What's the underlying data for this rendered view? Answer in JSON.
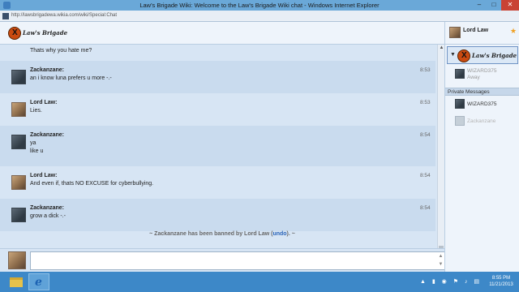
{
  "window": {
    "title": "Law's Brigade Wiki: Welcome to the Law's Brigade Wiki chat - Windows Internet Explorer",
    "minimize": "–",
    "maximize": "□",
    "close": "✕"
  },
  "address": {
    "url": "http://lawsbrigadewa.wikia.com/wiki/Special:Chat"
  },
  "logo_text": "Law's Brigade",
  "messages": [
    {
      "user": "",
      "time": "",
      "lines": [
        "Thats why you hate me?"
      ]
    },
    {
      "user": "Zackanzane:",
      "time": "8:53",
      "lines": [
        "an i know luna prefers u more -.-"
      ]
    },
    {
      "user": "Lord Law:",
      "time": "8:53",
      "lines": [
        "Lies."
      ]
    },
    {
      "user": "Zackanzane:",
      "time": "8:54",
      "lines": [
        "ya",
        "like u"
      ]
    },
    {
      "user": "Lord Law:",
      "time": "8:54",
      "lines": [
        "And even if, thats NO EXCUSE for cyberbullying."
      ]
    },
    {
      "user": "Zackanzane:",
      "time": "8:54",
      "lines": [
        "grow a dick -.-"
      ]
    }
  ],
  "status": {
    "prefix": "~ Zackanzane has been banned by Lord Law (",
    "undo": "undo",
    "suffix": "). ~"
  },
  "sidebar": {
    "me": "Lord Law",
    "star": "★",
    "room_caret": "▼",
    "users": [
      {
        "name": "WIZARD375",
        "status": "Away"
      }
    ],
    "pm_header": "Private Messages",
    "pm_users": [
      {
        "name": "WIZARD375"
      },
      {
        "name": "Zackanzane"
      }
    ]
  },
  "scroll": {
    "up": "▲",
    "down": "▼"
  },
  "taskbar": {
    "time": "8:55 PM",
    "date": "11/21/2013",
    "tray_icons": "▲ ▮ ◉ ⚑ ♪ ▤"
  }
}
